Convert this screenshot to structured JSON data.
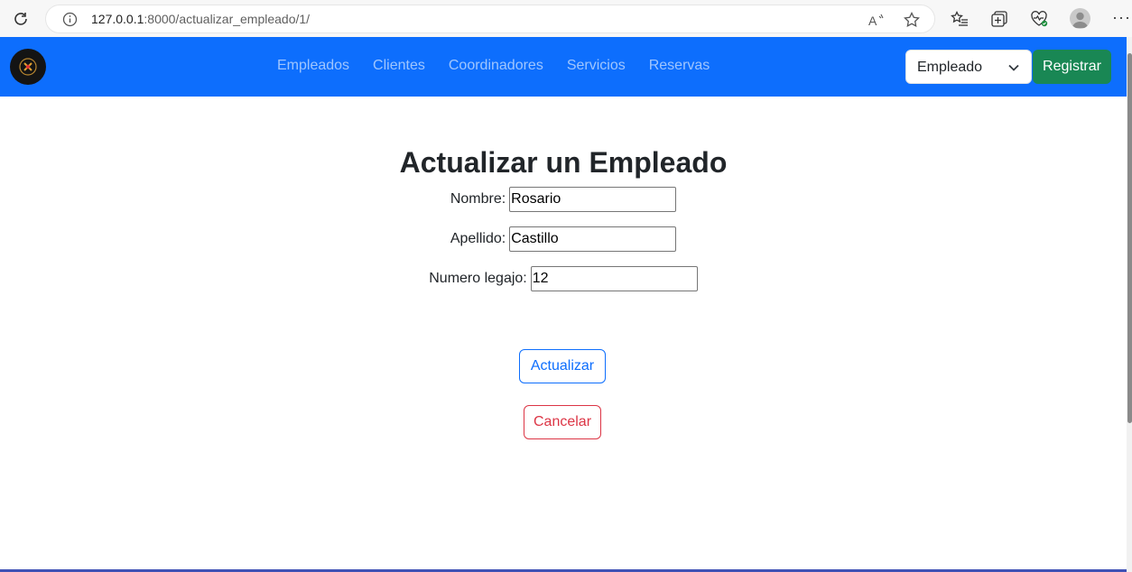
{
  "browser": {
    "url_host": "127.0.0.1",
    "url_path": ":8000/actualizar_empleado/1/"
  },
  "navbar": {
    "links": [
      "Empleados",
      "Clientes",
      "Coordinadores",
      "Servicios",
      "Reservas"
    ],
    "role_select_value": "Empleado",
    "register_label": "Registrar",
    "bg_color": "#0d6efd"
  },
  "form": {
    "title": "Actualizar un Empleado",
    "fields": [
      {
        "label": "Nombre:",
        "value": "Rosario"
      },
      {
        "label": "Apellido:",
        "value": "Castillo"
      },
      {
        "label": "Numero legajo:",
        "value": "12"
      }
    ],
    "update_label": "Actualizar",
    "cancel_label": "Cancelar"
  },
  "icons": [
    "reload-icon",
    "info-icon",
    "read-aloud-icon",
    "favorite-star-icon",
    "favorites-list-icon",
    "collections-icon",
    "browser-essentials-icon",
    "profile-icon",
    "more-icon",
    "logo-icon",
    "chevron-down-icon"
  ]
}
